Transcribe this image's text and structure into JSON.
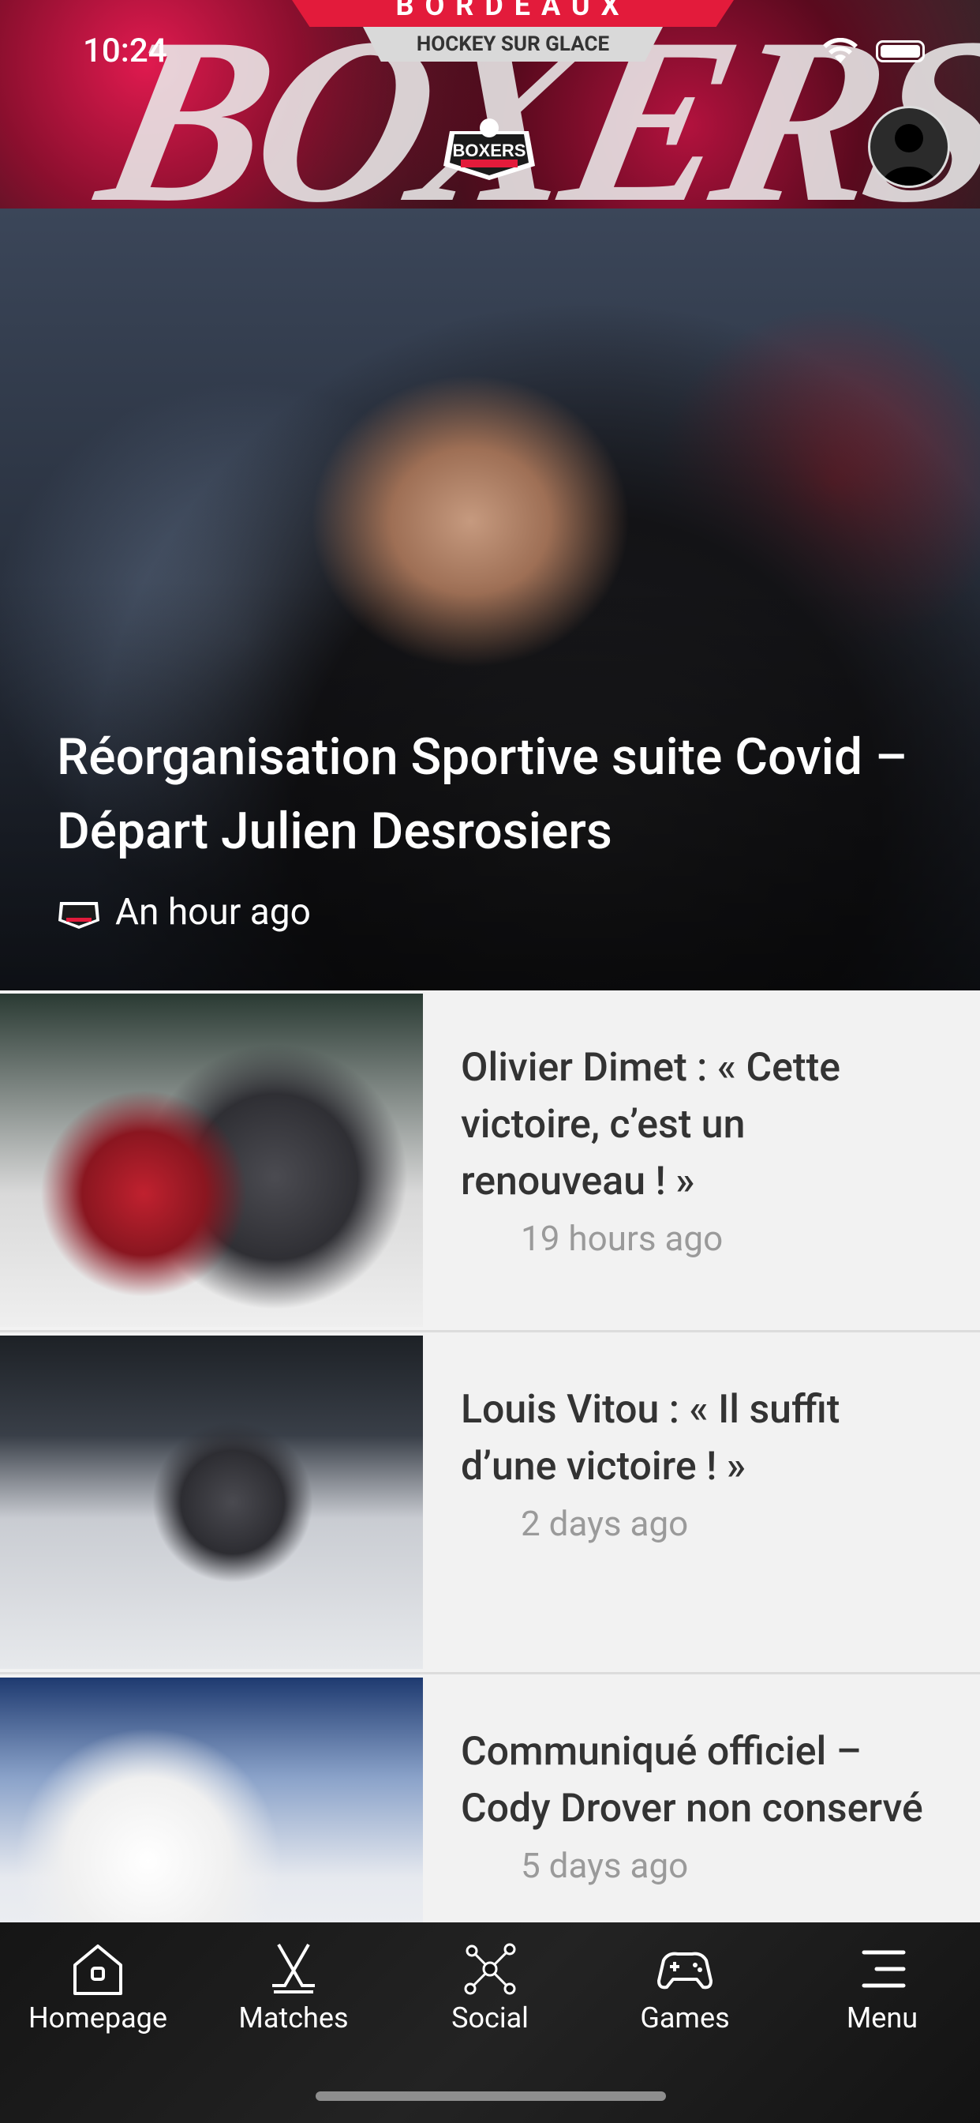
{
  "status_bar": {
    "time": "10:24"
  },
  "header": {
    "banner_top": "BORDEAUX",
    "banner_sub": "HOCKEY SUR GLACE",
    "brush_text": "BOXERS",
    "logo_text": "BOXERS"
  },
  "hero": {
    "title": "Réorganisation Sportive suite Covid – Départ Julien Desrosiers",
    "time": "An hour ago"
  },
  "news": [
    {
      "title": "Olivier Dimet : « Cette victoire, c’est un renouveau ! »",
      "time": "19 hours ago"
    },
    {
      "title": "Louis Vitou : « Il suffit d’une victoire ! »",
      "time": "2 days ago"
    },
    {
      "title": "Communiqué officiel – Cody Drover non conservé",
      "time": "5 days ago"
    }
  ],
  "tabbar": {
    "items": [
      {
        "label": "Homepage",
        "icon": "home-icon"
      },
      {
        "label": "Matches",
        "icon": "hockey-sticks-icon"
      },
      {
        "label": "Social",
        "icon": "network-icon"
      },
      {
        "label": "Games",
        "icon": "gamepad-icon"
      },
      {
        "label": "Menu",
        "icon": "menu-icon"
      }
    ]
  }
}
